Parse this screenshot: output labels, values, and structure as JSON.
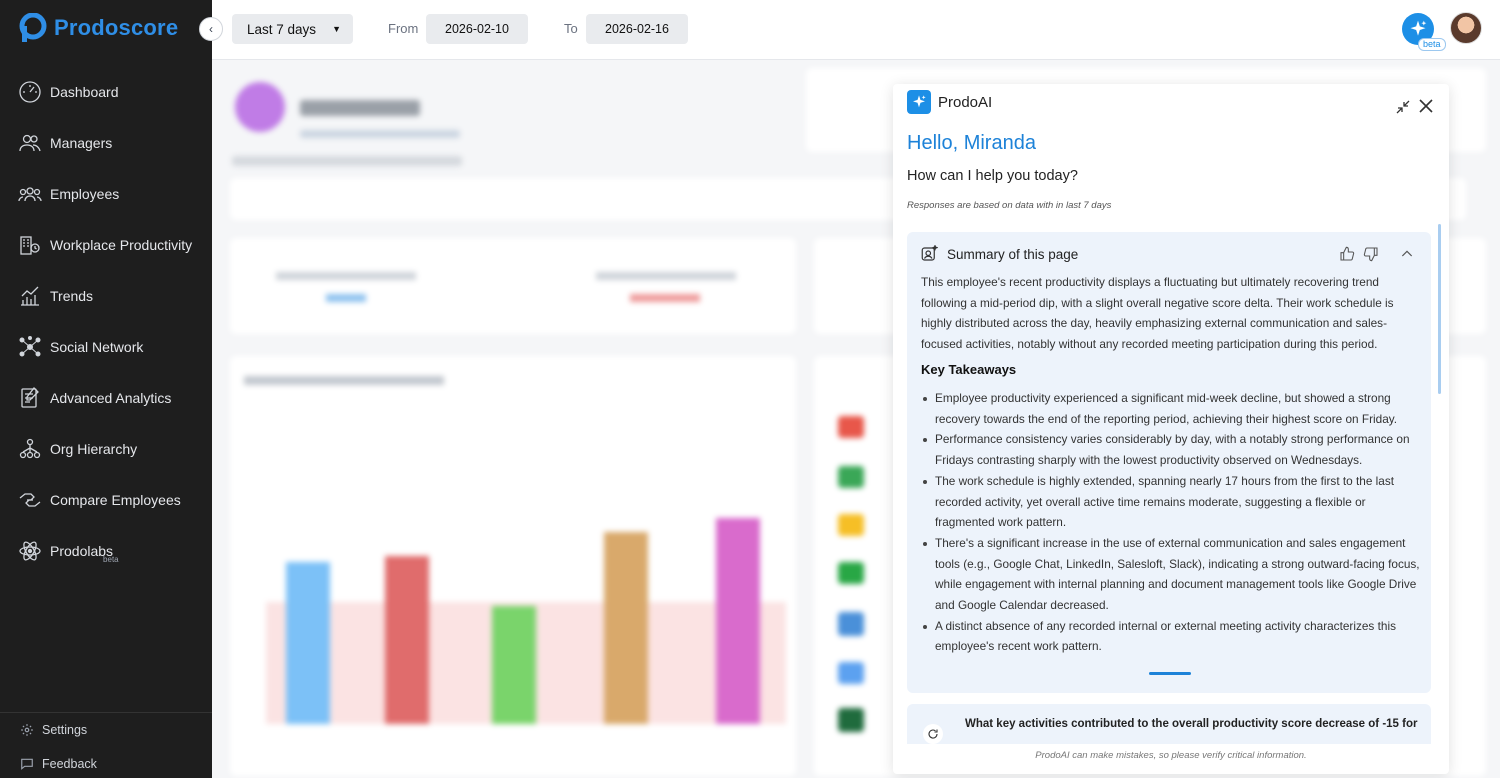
{
  "brand": {
    "name": "Prodoscore"
  },
  "sidebar": {
    "items": [
      {
        "label": "Dashboard",
        "icon": "gauge-icon"
      },
      {
        "label": "Managers",
        "icon": "managers-icon"
      },
      {
        "label": "Employees",
        "icon": "employees-icon"
      },
      {
        "label": "Workplace Productivity",
        "icon": "workplace-icon"
      },
      {
        "label": "Trends",
        "icon": "trends-icon"
      },
      {
        "label": "Social Network",
        "icon": "network-icon"
      },
      {
        "label": "Advanced Analytics",
        "icon": "analytics-icon"
      },
      {
        "label": "Org Hierarchy",
        "icon": "hierarchy-icon"
      },
      {
        "label": "Compare Employees",
        "icon": "compare-icon"
      },
      {
        "label": "Prodolabs",
        "icon": "atom-icon",
        "sup": "beta"
      }
    ],
    "bottom": [
      {
        "label": "Settings",
        "icon": "gear-icon"
      },
      {
        "label": "Feedback",
        "icon": "feedback-icon"
      }
    ]
  },
  "topbar": {
    "period": "Last 7 days",
    "from_label": "From",
    "from_date": "2026-02-10",
    "to_label": "To",
    "to_date": "2026-02-16",
    "ai_beta": "beta"
  },
  "panel": {
    "title": "ProdoAI",
    "greeting": "Hello, Miranda",
    "prompt": "How can I help you today?",
    "note": "Responses are based on data with in last 7 days",
    "summary_title": "Summary of this page",
    "summary_text": "This employee's recent productivity displays a fluctuating but ultimately recovering trend following a mid-period dip, with a slight overall negative score delta. Their work schedule is highly distributed across the day, heavily emphasizing external communication and sales-focused activities, notably without any recorded meeting participation during this period.",
    "takeaways_title": "Key Takeaways",
    "takeaways": [
      "Employee productivity experienced a significant mid-week decline, but showed a strong recovery towards the end of the reporting period, achieving their highest score on Friday.",
      "Performance consistency varies considerably by day, with a notably strong performance on Fridays contrasting sharply with the lowest productivity observed on Wednesdays.",
      "The work schedule is highly extended, spanning nearly 17 hours from the first to the last recorded activity, yet overall active time remains moderate, suggesting a flexible or fragmented work pattern.",
      "There's a significant increase in the use of external communication and sales engagement tools (e.g., Google Chat, LinkedIn, Salesloft, Slack), indicating a strong outward-facing focus, while engagement with internal planning and document management tools like Google Drive and Google Calendar decreased.",
      "A distinct absence of any recorded internal or external meeting activity characterizes this employee's recent work pattern."
    ],
    "question": "What key activities contributed to the overall productivity score decrease of -15 for",
    "disclaimer": "ProdoAI can make mistakes, so please verify critical information."
  },
  "colors": {
    "accent": "#1d82d8",
    "sidebar_bg": "#1e1e1e",
    "summary_bg": "#edf3fb"
  },
  "background_chart": {
    "bars": [
      {
        "color": "#7cc1f7",
        "value": 53
      },
      {
        "color": "#e06c6c",
        "value": 55
      },
      {
        "color": "#7ad46b",
        "value": 38
      },
      {
        "color": "#d9a96b",
        "value": 63
      },
      {
        "color": "#d96bcc",
        "value": 68
      }
    ]
  }
}
